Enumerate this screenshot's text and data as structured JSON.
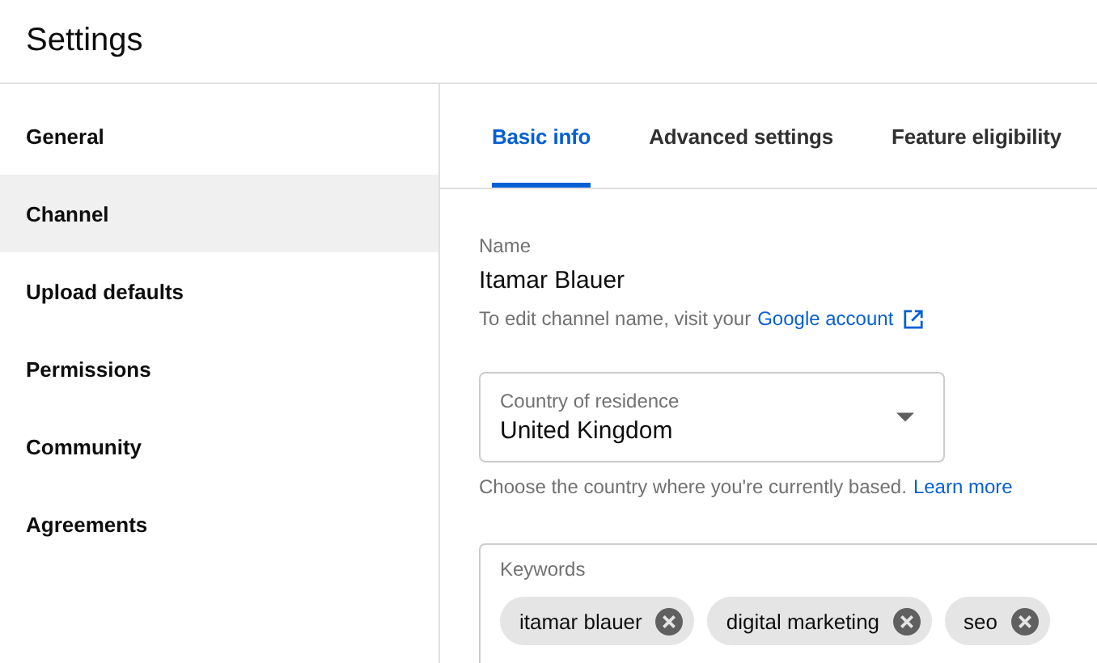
{
  "header": {
    "title": "Settings"
  },
  "sidebar": {
    "items": [
      {
        "label": "General",
        "selected": false
      },
      {
        "label": "Channel",
        "selected": true
      },
      {
        "label": "Upload defaults",
        "selected": false
      },
      {
        "label": "Permissions",
        "selected": false
      },
      {
        "label": "Community",
        "selected": false
      },
      {
        "label": "Agreements",
        "selected": false
      }
    ]
  },
  "tabs": [
    {
      "label": "Basic info",
      "selected": true
    },
    {
      "label": "Advanced settings",
      "selected": false
    },
    {
      "label": "Feature eligibility",
      "selected": false
    }
  ],
  "name_field": {
    "label": "Name",
    "value": "Itamar Blauer",
    "hint": "To edit channel name, visit your",
    "link": "Google account"
  },
  "country_field": {
    "label": "Country of residence",
    "value": "United Kingdom",
    "hint": "Choose the country where you're currently based.",
    "link": "Learn more"
  },
  "keywords_field": {
    "label": "Keywords",
    "chips": [
      "itamar blauer",
      "digital marketing",
      "seo"
    ]
  }
}
